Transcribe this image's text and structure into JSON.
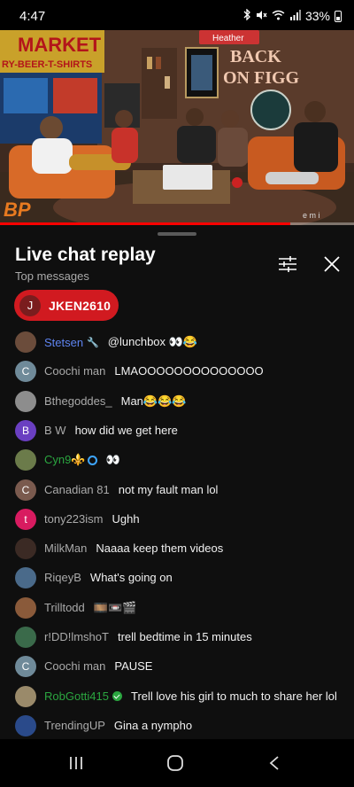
{
  "status_bar": {
    "time": "4:47",
    "battery": "33%",
    "icons": [
      "bluetooth-icon",
      "mute-icon",
      "wifi-icon",
      "signal-icon",
      "battery-icon"
    ]
  },
  "video": {
    "description_icon": "video-thumbnail",
    "sign_top": "MARKET",
    "sign_sub": "RY-BEER-T-SHIRTS",
    "name_tag": "Heather",
    "wall_text_1": "BACK",
    "wall_text_2": "ON FIGG",
    "logo": "BP",
    "watermark": "e  m  i",
    "progress_fraction": 0.82
  },
  "chat_panel": {
    "title": "Live chat replay",
    "subtitle": "Top messages",
    "filter_icon": "tune-icon",
    "close_icon": "close-icon",
    "pinned_user": {
      "initial": "J",
      "name": "JKEN2610"
    }
  },
  "messages": [
    {
      "author": "Stetsen",
      "author_style": "mod",
      "badge": "🔧",
      "text": "@lunchbox 👀😂",
      "avatar_color": "#6b4c3b",
      "avatar_letter": ""
    },
    {
      "author": "Coochi man",
      "author_style": "",
      "badge": "",
      "text": "LMAOOOOOOOOOOOOOO",
      "avatar_color": "#6f8a99",
      "avatar_letter": "C"
    },
    {
      "author": "Bthegoddes_",
      "author_style": "",
      "badge": "",
      "text": "Man😂😂😂",
      "avatar_color": "#8d8d8d",
      "avatar_letter": ""
    },
    {
      "author": "B W",
      "author_style": "",
      "badge": "",
      "text": "how did we get here",
      "avatar_color": "#6a3fc1",
      "avatar_letter": "B"
    },
    {
      "author": "Cyn9⚜️",
      "author_style": "member",
      "badge": "gear",
      "text": "👀",
      "avatar_color": "#6b7b4a",
      "avatar_letter": ""
    },
    {
      "author": "Canadian 81",
      "author_style": "",
      "badge": "",
      "text": "not my fault man lol",
      "avatar_color": "#7a5a4e",
      "avatar_letter": "C"
    },
    {
      "author": "tony223ism",
      "author_style": "",
      "badge": "",
      "text": "Ughh",
      "avatar_color": "#d81b60",
      "avatar_letter": "t"
    },
    {
      "author": "MilkMan",
      "author_style": "",
      "badge": "",
      "text": "Naaaa keep them videos",
      "avatar_color": "#3b2a24",
      "avatar_letter": ""
    },
    {
      "author": "RiqeyB",
      "author_style": "",
      "badge": "",
      "text": "What's going on",
      "avatar_color": "#4a6a8a",
      "avatar_letter": ""
    },
    {
      "author": "Trilltodd",
      "author_style": "",
      "badge": "",
      "text": "🎞️📼🎬",
      "avatar_color": "#8a5a3a",
      "avatar_letter": ""
    },
    {
      "author": "r!DD!lmshoT",
      "author_style": "",
      "badge": "",
      "text": "trell bedtime in 15 minutes",
      "avatar_color": "#3a6a4a",
      "avatar_letter": ""
    },
    {
      "author": "Coochi man",
      "author_style": "",
      "badge": "",
      "text": "PAUSE",
      "avatar_color": "#6f8a99",
      "avatar_letter": "C"
    },
    {
      "author": "RobGotti415",
      "author_style": "member",
      "badge": "verified",
      "text": "Trell love his girl to much to share her lol",
      "avatar_color": "#9a8a6a",
      "avatar_letter": ""
    },
    {
      "author": "TrendingUP",
      "author_style": "",
      "badge": "",
      "text": "Gina a nympho",
      "avatar_color": "#2a4a8a",
      "avatar_letter": ""
    }
  ],
  "nav_bar": {
    "recents_icon": "recents-icon",
    "home_icon": "home-icon",
    "back_icon": "back-icon"
  }
}
